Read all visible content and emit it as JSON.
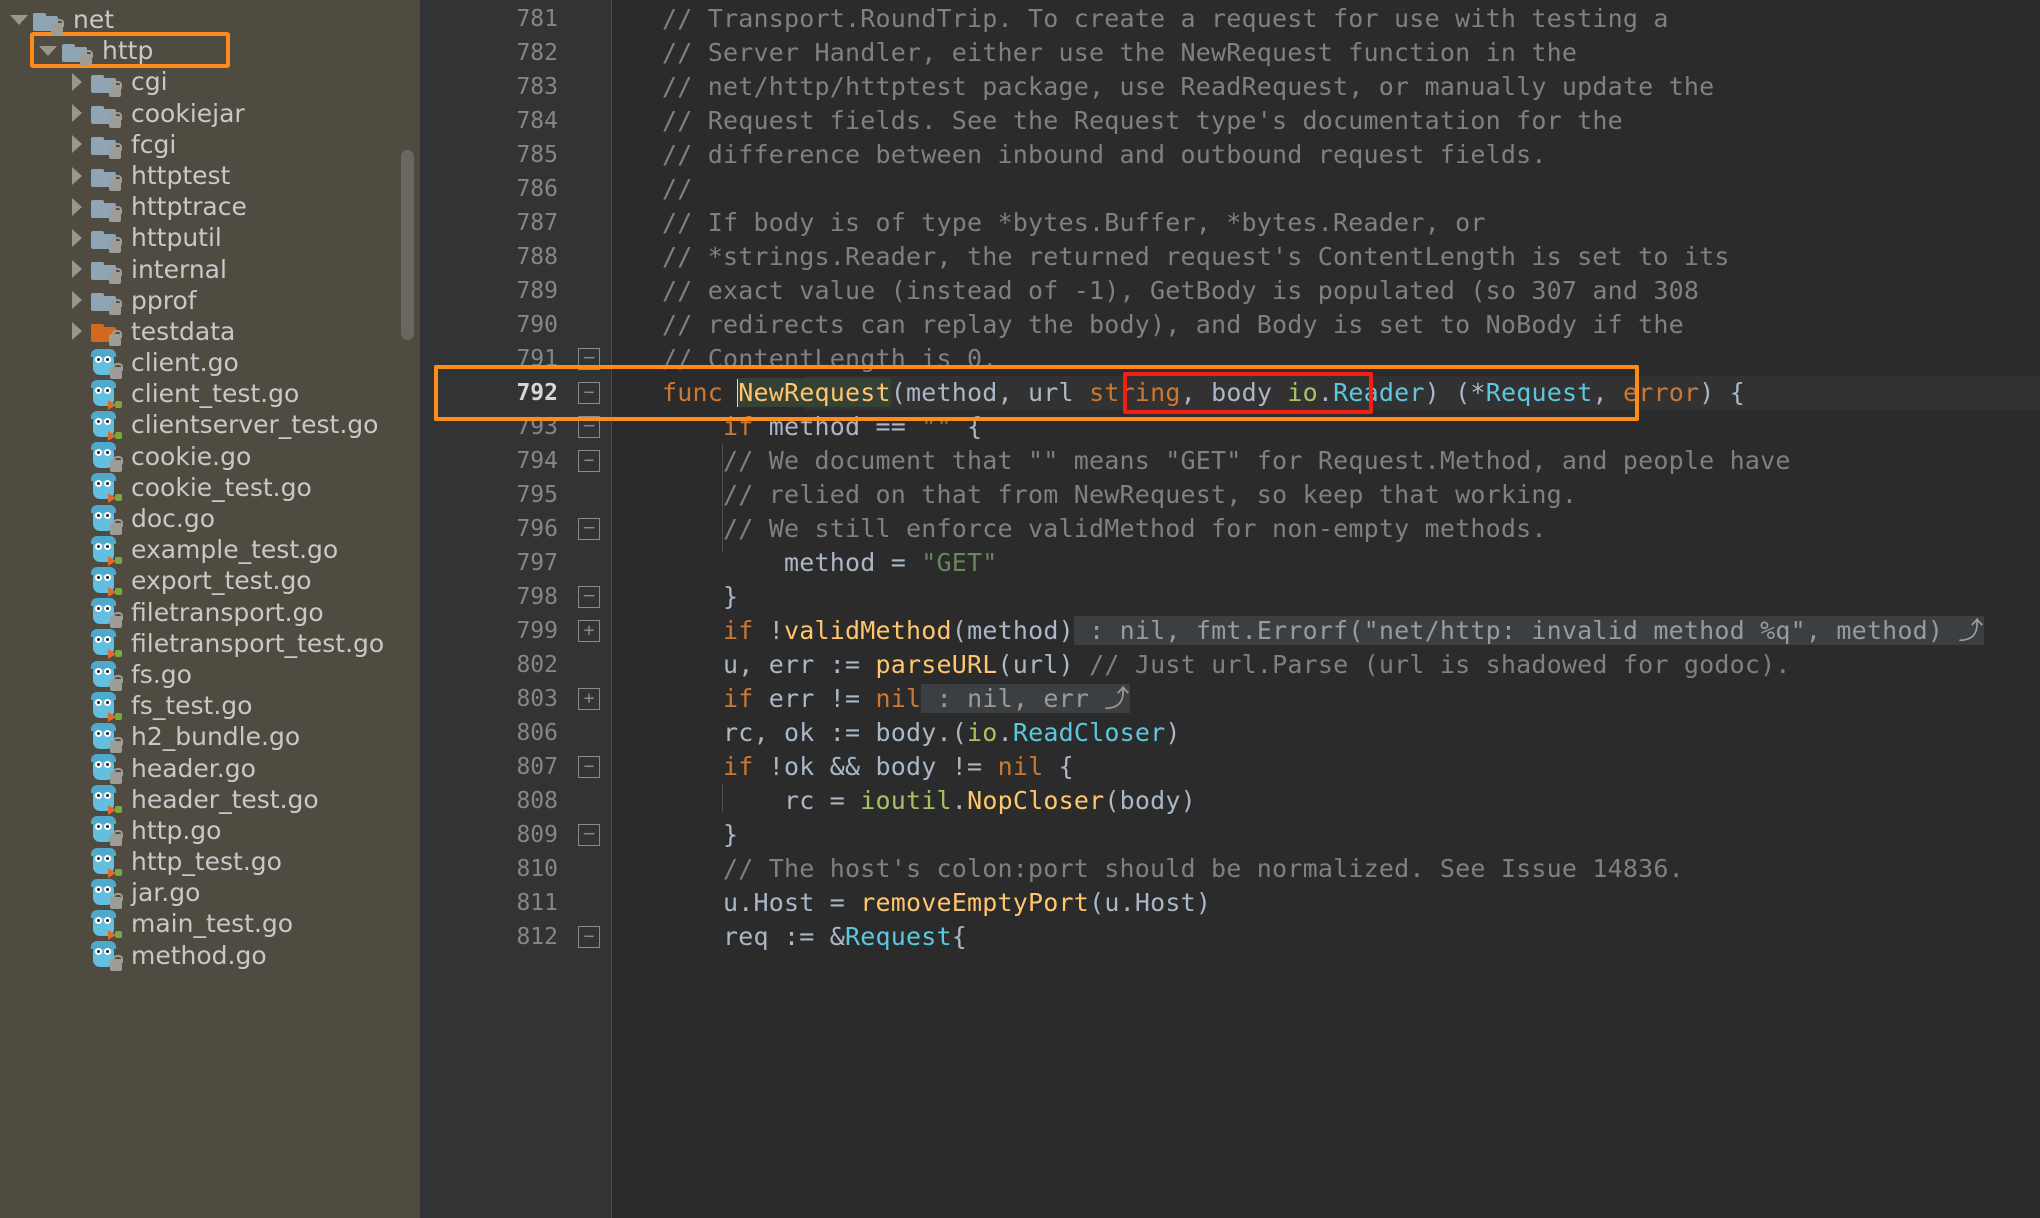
{
  "sidebar": {
    "name": "project-tree",
    "scrollbar_visible": true,
    "items": [
      {
        "label": "net",
        "type": "folder",
        "depth": 0,
        "twisty": "down",
        "icon": "folder-icon",
        "badge": "lock",
        "highlighted": false
      },
      {
        "label": "http",
        "type": "folder",
        "depth": 1,
        "twisty": "down",
        "icon": "folder-icon",
        "badge": "lock",
        "highlighted": true
      },
      {
        "label": "cgi",
        "type": "folder",
        "depth": 2,
        "twisty": "right",
        "icon": "folder-icon",
        "badge": "lock",
        "highlighted": false
      },
      {
        "label": "cookiejar",
        "type": "folder",
        "depth": 2,
        "twisty": "right",
        "icon": "folder-icon",
        "badge": "lock",
        "highlighted": false
      },
      {
        "label": "fcgi",
        "type": "folder",
        "depth": 2,
        "twisty": "right",
        "icon": "folder-icon",
        "badge": "lock",
        "highlighted": false
      },
      {
        "label": "httptest",
        "type": "folder",
        "depth": 2,
        "twisty": "right",
        "icon": "folder-icon",
        "badge": "lock",
        "highlighted": false
      },
      {
        "label": "httptrace",
        "type": "folder",
        "depth": 2,
        "twisty": "right",
        "icon": "folder-icon",
        "badge": "lock",
        "highlighted": false
      },
      {
        "label": "httputil",
        "type": "folder",
        "depth": 2,
        "twisty": "right",
        "icon": "folder-icon",
        "badge": "lock",
        "highlighted": false
      },
      {
        "label": "internal",
        "type": "folder",
        "depth": 2,
        "twisty": "right",
        "icon": "folder-icon",
        "badge": "lock",
        "highlighted": false
      },
      {
        "label": "pprof",
        "type": "folder",
        "depth": 2,
        "twisty": "right",
        "icon": "folder-icon",
        "badge": "lock",
        "highlighted": false
      },
      {
        "label": "testdata",
        "type": "folder-orange",
        "depth": 2,
        "twisty": "right",
        "icon": "folder-icon",
        "badge": "lock",
        "highlighted": false
      },
      {
        "label": "client.go",
        "type": "go",
        "depth": 2,
        "twisty": "none",
        "icon": "go-file-icon",
        "badge": "lock",
        "highlighted": false
      },
      {
        "label": "client_test.go",
        "type": "go-test",
        "depth": 2,
        "twisty": "none",
        "icon": "go-test-file-icon",
        "badge": "test",
        "highlighted": false
      },
      {
        "label": "clientserver_test.go",
        "type": "go-test",
        "depth": 2,
        "twisty": "none",
        "icon": "go-test-file-icon",
        "badge": "test",
        "highlighted": false
      },
      {
        "label": "cookie.go",
        "type": "go",
        "depth": 2,
        "twisty": "none",
        "icon": "go-file-icon",
        "badge": "lock",
        "highlighted": false
      },
      {
        "label": "cookie_test.go",
        "type": "go-test",
        "depth": 2,
        "twisty": "none",
        "icon": "go-test-file-icon",
        "badge": "test",
        "highlighted": false
      },
      {
        "label": "doc.go",
        "type": "go",
        "depth": 2,
        "twisty": "none",
        "icon": "go-file-icon",
        "badge": "lock",
        "highlighted": false
      },
      {
        "label": "example_test.go",
        "type": "go-test",
        "depth": 2,
        "twisty": "none",
        "icon": "go-test-file-icon",
        "badge": "test",
        "highlighted": false
      },
      {
        "label": "export_test.go",
        "type": "go-test",
        "depth": 2,
        "twisty": "none",
        "icon": "go-test-file-icon",
        "badge": "test",
        "highlighted": false
      },
      {
        "label": "filetransport.go",
        "type": "go",
        "depth": 2,
        "twisty": "none",
        "icon": "go-file-icon",
        "badge": "lock",
        "highlighted": false
      },
      {
        "label": "filetransport_test.go",
        "type": "go-test",
        "depth": 2,
        "twisty": "none",
        "icon": "go-test-file-icon",
        "badge": "test",
        "highlighted": false
      },
      {
        "label": "fs.go",
        "type": "go",
        "depth": 2,
        "twisty": "none",
        "icon": "go-file-icon",
        "badge": "lock",
        "highlighted": false
      },
      {
        "label": "fs_test.go",
        "type": "go-test",
        "depth": 2,
        "twisty": "none",
        "icon": "go-test-file-icon",
        "badge": "test",
        "highlighted": false
      },
      {
        "label": "h2_bundle.go",
        "type": "go",
        "depth": 2,
        "twisty": "none",
        "icon": "go-file-icon",
        "badge": "lock",
        "highlighted": false
      },
      {
        "label": "header.go",
        "type": "go",
        "depth": 2,
        "twisty": "none",
        "icon": "go-file-icon",
        "badge": "lock",
        "highlighted": false
      },
      {
        "label": "header_test.go",
        "type": "go-test",
        "depth": 2,
        "twisty": "none",
        "icon": "go-test-file-icon",
        "badge": "test",
        "highlighted": false
      },
      {
        "label": "http.go",
        "type": "go",
        "depth": 2,
        "twisty": "none",
        "icon": "go-file-icon",
        "badge": "lock",
        "highlighted": false
      },
      {
        "label": "http_test.go",
        "type": "go-test",
        "depth": 2,
        "twisty": "none",
        "icon": "go-test-file-icon",
        "badge": "test",
        "highlighted": false
      },
      {
        "label": "jar.go",
        "type": "go",
        "depth": 2,
        "twisty": "none",
        "icon": "go-file-icon",
        "badge": "lock",
        "highlighted": false
      },
      {
        "label": "main_test.go",
        "type": "go-test",
        "depth": 2,
        "twisty": "none",
        "icon": "go-test-file-icon",
        "badge": "test",
        "highlighted": false
      },
      {
        "label": "method.go",
        "type": "go",
        "depth": 2,
        "twisty": "none",
        "icon": "go-file-icon",
        "badge": "lock",
        "highlighted": false
      }
    ]
  },
  "editor": {
    "name": "code-editor",
    "current_line": 792,
    "lines": [
      {
        "no": "781",
        "fold": "none",
        "tokens": [
          {
            "t": "// Transport.RoundTrip. To create a request for use with testing a",
            "c": "c-comment",
            "indent": 0
          }
        ]
      },
      {
        "no": "782",
        "fold": "none",
        "tokens": [
          {
            "t": "// Server Handler, either use the NewRequest function in the",
            "c": "c-comment",
            "indent": 0
          }
        ]
      },
      {
        "no": "783",
        "fold": "none",
        "tokens": [
          {
            "t": "// net/http/httptest package, use ReadRequest, or manually update the",
            "c": "c-comment",
            "indent": 0
          }
        ]
      },
      {
        "no": "784",
        "fold": "none",
        "tokens": [
          {
            "t": "// Request fields. See the Request type's documentation for the",
            "c": "c-comment",
            "indent": 0
          }
        ]
      },
      {
        "no": "785",
        "fold": "none",
        "tokens": [
          {
            "t": "// difference between inbound and outbound request fields.",
            "c": "c-comment",
            "indent": 0
          }
        ]
      },
      {
        "no": "786",
        "fold": "none",
        "tokens": [
          {
            "t": "//",
            "c": "c-comment",
            "indent": 0
          }
        ]
      },
      {
        "no": "787",
        "fold": "none",
        "tokens": [
          {
            "t": "// If body is of type *bytes.Buffer, *bytes.Reader, or",
            "c": "c-comment",
            "indent": 0
          }
        ]
      },
      {
        "no": "788",
        "fold": "none",
        "tokens": [
          {
            "t": "// *strings.Reader, the returned request's ContentLength is set to its",
            "c": "c-comment",
            "indent": 0
          }
        ]
      },
      {
        "no": "789",
        "fold": "none",
        "tokens": [
          {
            "t": "// exact value (instead of -1), GetBody is populated (so 307 and 308",
            "c": "c-comment",
            "indent": 0
          }
        ]
      },
      {
        "no": "790",
        "fold": "none",
        "tokens": [
          {
            "t": "// redirects can replay the body), and Body is set to NoBody if the",
            "c": "c-comment",
            "indent": 0
          }
        ]
      },
      {
        "no": "791",
        "fold": "brace-top",
        "tokens": [
          {
            "t": "// ContentLength is 0.",
            "c": "c-comment",
            "indent": 0
          }
        ]
      },
      {
        "no": "792",
        "fold": "collapse",
        "current": true,
        "tokens": []
      },
      {
        "no": "793",
        "fold": "brace-end",
        "tokens": []
      },
      {
        "no": "794",
        "fold": "minus",
        "tokens": [
          {
            "t": "// We document that \"\" means \"GET\" for Request.Method, and people have",
            "c": "c-comment",
            "indent": 4
          }
        ]
      },
      {
        "no": "795",
        "fold": "none",
        "tokens": [
          {
            "t": "// relied on that from NewRequest, so keep that working.",
            "c": "c-comment",
            "indent": 4
          }
        ]
      },
      {
        "no": "796",
        "fold": "brace-end2",
        "tokens": [
          {
            "t": "// We still enforce validMethod for non-empty methods.",
            "c": "c-comment",
            "indent": 4
          }
        ]
      },
      {
        "no": "797",
        "fold": "none",
        "tokens": []
      },
      {
        "no": "798",
        "fold": "brace-end3",
        "tokens": []
      },
      {
        "no": "799",
        "fold": "plus",
        "tokens": []
      },
      {
        "no": "802",
        "fold": "none",
        "tokens": []
      },
      {
        "no": "803",
        "fold": "plus",
        "tokens": []
      },
      {
        "no": "806",
        "fold": "none",
        "tokens": []
      },
      {
        "no": "807",
        "fold": "minus",
        "tokens": []
      },
      {
        "no": "808",
        "fold": "none",
        "tokens": []
      },
      {
        "no": "809",
        "fold": "brace-end4",
        "tokens": []
      },
      {
        "no": "810",
        "fold": "none",
        "tokens": [
          {
            "t": "// The host's colon:port should be normalized. See Issue 14836.",
            "c": "c-comment",
            "indent": 4
          }
        ]
      },
      {
        "no": "811",
        "fold": "none",
        "tokens": []
      },
      {
        "no": "812",
        "fold": "minus",
        "tokens": []
      }
    ],
    "code_text": {
      "l792_func": "func ",
      "l792_name": "NewRequest",
      "l792_params_open": "(",
      "l792_method_url": "method, url ",
      "l792_string": "string",
      "l792_comma": ", ",
      "l792_body": "body ",
      "l792_io": "io",
      "l792_dot": ".",
      "l792_reader": "Reader",
      "l792_close": ")",
      "l792_ret_open": " (*",
      "l792_request": "Request",
      "l792_ret_comma": ", ",
      "l792_error": "error",
      "l792_ret_close": ") {",
      "l793_if": "if ",
      "l793_method": "method == ",
      "l793_empty": "\"\"",
      "l793_brace": " {",
      "l797_method": "method = ",
      "l797_get": "\"GET\"",
      "l798_brace": "}",
      "l799_if": "if ",
      "l799_bang": "!",
      "l799_validmethod": "validMethod",
      "l799_open": "(",
      "l799_method": "method",
      "l799_close": ")",
      "l799_fold": " : nil, fmt.Errorf(\"net/http: invalid method %q\", method) ⤴",
      "l802_uerr": "u, err := ",
      "l802_parseurl": "parseURL",
      "l802_open": "(url)",
      "l802_comment": " // Just url.Parse (url is shadowed for godoc).",
      "l803_if": "if ",
      "l803_err": "err != ",
      "l803_nil": "nil",
      "l803_fold": " : nil, err ⤴",
      "l806_rcok": "rc, ok := body.(",
      "l806_io": "io",
      "l806_dot": ".",
      "l806_readcloser": "ReadCloser",
      "l806_close": ")",
      "l807_if": "if ",
      "l807_cond": "!ok && body != ",
      "l807_nil": "nil",
      "l807_brace": " {",
      "l808_rc": "rc = ",
      "l808_ioutil": "ioutil",
      "l808_dot": ".",
      "l808_nopcloser": "NopCloser",
      "l808_args": "(body)",
      "l809_brace": "}",
      "l811_uhost": "u.Host = ",
      "l811_remove": "removeEmptyPort",
      "l811_args": "(u.Host)",
      "l812_req": "req := &",
      "l812_request": "Request",
      "l812_brace": "{"
    }
  },
  "annotations": {
    "orange_box_tree_label": "http",
    "orange_box_code_label": "func NewRequest(method, url string, body io.Reader) (*Request, error) {",
    "red_box_code_label": "body io.Reader)",
    "colors": {
      "highlight_orange": "#ff8c1a",
      "highlight_red": "#f41f13",
      "sidebar_bg": "#4f4b41",
      "editor_bg": "#2b2b2b",
      "gutter_bg": "#313335",
      "current_line_bg": "#323232",
      "keyword": "#cc7832",
      "string": "#6a8759",
      "comment": "#808080",
      "function": "#ffc66d",
      "type": "#5cc8e0",
      "package": "#a5c261",
      "plain_text": "#a9b7c6"
    }
  }
}
